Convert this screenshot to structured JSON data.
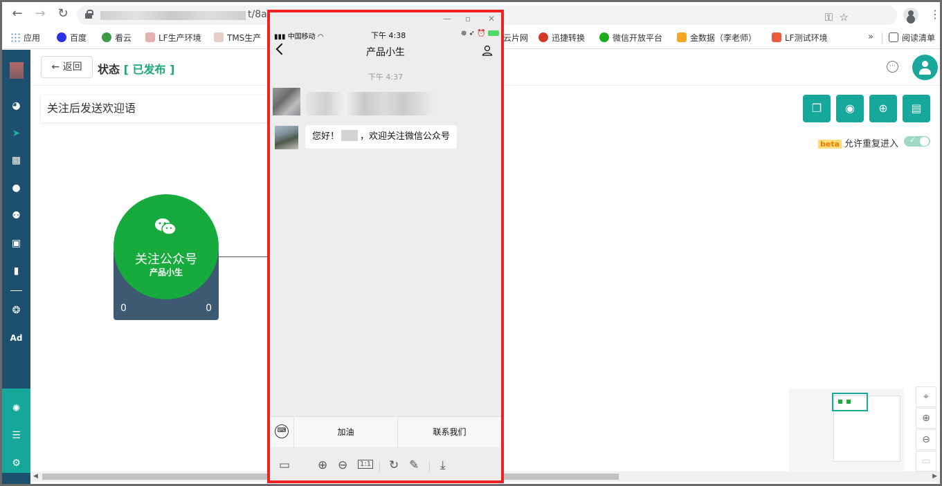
{
  "browser": {
    "url_tail": "t/8a",
    "bookmarks": [
      {
        "label": "应用",
        "color": "#e8453c"
      },
      {
        "label": "百度",
        "color": "#2932e1"
      },
      {
        "label": "看云",
        "color": "#3a9a46"
      },
      {
        "label": "LF生产环境",
        "color": "#e2b0b0"
      },
      {
        "label": "TMS生产",
        "color": "#e6d0c5"
      },
      {
        "label": "云片网",
        "color": "#ffffff"
      },
      {
        "label": "迅捷转换",
        "color": "#d43a2a"
      },
      {
        "label": "微信开放平台",
        "color": "#1aad19"
      },
      {
        "label": "金数据（李老师）",
        "color": "#f5a623"
      },
      {
        "label": "LF测试环境",
        "color": "#e85d3e"
      }
    ],
    "reading_list": "阅读清单",
    "more": "»"
  },
  "sidebar": {
    "icons": [
      "dashboard-icon",
      "send-icon",
      "layout-icon",
      "user-icon",
      "users-icon",
      "contact-book-icon",
      "bar-chart-icon",
      "wechat-icon",
      "ad-icon",
      "automation-icon",
      "server-icon",
      "settings-icon"
    ],
    "ad_label": "Ad"
  },
  "header": {
    "back_label": "返回",
    "state_label": "状态",
    "state_value": "已发布"
  },
  "canvas": {
    "welcome_step": "关注后发送欢迎语",
    "beta_tag": "beta",
    "repeat_label": "允许重复进入",
    "repeat_enabled": true,
    "node": {
      "title": "关注公众号",
      "subtitle": "产品小生",
      "count_left": "0",
      "count_right": "0"
    },
    "toolbar_icons": [
      "copy-icon",
      "target-icon",
      "add-icon",
      "layout-icon"
    ],
    "zoom_icons": [
      "locate-icon",
      "zoom-in-icon",
      "zoom-out-icon",
      "lock-icon"
    ]
  },
  "phone": {
    "carrier": "中国移动",
    "status_time": "下午 4:38",
    "title": "产品小生",
    "chat_time": "下午 4:37",
    "message_prefix": "您好！",
    "message_suffix": "，欢迎关注微信公众号",
    "menu": [
      "加油",
      "联系我们"
    ],
    "tools": [
      "layout-icon",
      "zoom-in-icon",
      "zoom-out-icon",
      "actual-size-icon",
      "rotate-icon",
      "edit-icon",
      "download-icon"
    ],
    "actual_size": "1:1"
  },
  "colors": {
    "accent": "#16a89a",
    "published": "#19a974",
    "node_green": "#17ab3d",
    "sidebar": "#1d4f6e",
    "highlight_border": "#ee2222"
  }
}
